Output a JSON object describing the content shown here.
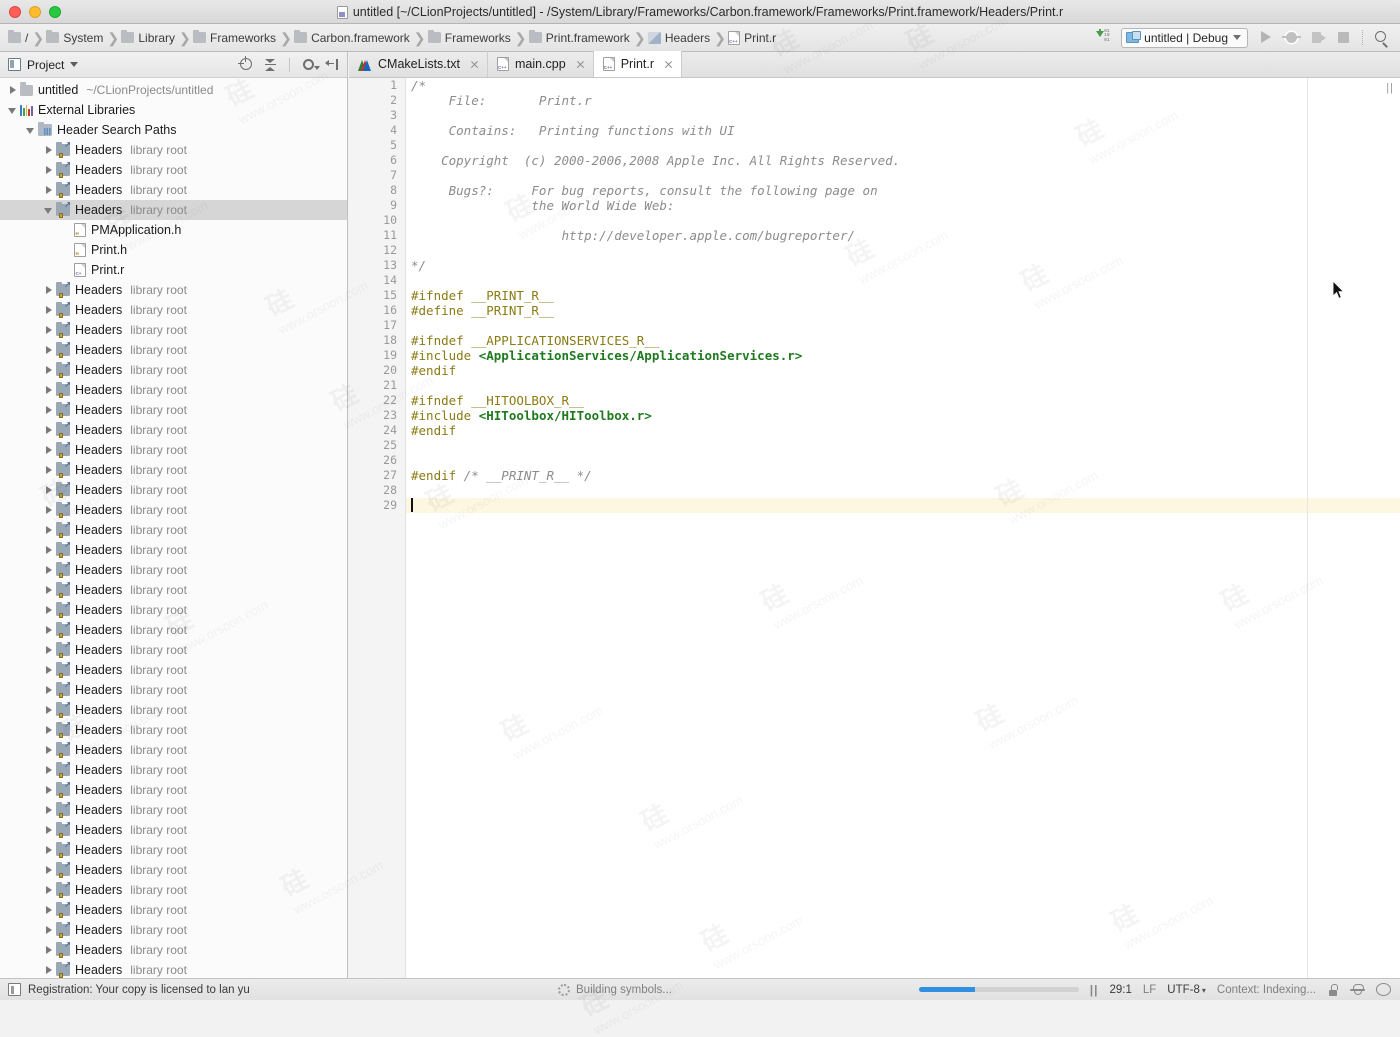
{
  "window": {
    "title": "untitled [~/CLionProjects/untitled] - /System/Library/Frameworks/Carbon.framework/Frameworks/Print.framework/Headers/Print.r",
    "controls": [
      "close",
      "minimize",
      "zoom"
    ]
  },
  "breadcrumbs": [
    {
      "label": "/",
      "icon": "folder-icon"
    },
    {
      "label": "System",
      "icon": "folder-icon"
    },
    {
      "label": "Library",
      "icon": "folder-icon"
    },
    {
      "label": "Frameworks",
      "icon": "folder-icon"
    },
    {
      "label": "Carbon.framework",
      "icon": "folder-icon"
    },
    {
      "label": "Frameworks",
      "icon": "folder-icon"
    },
    {
      "label": "Print.framework",
      "icon": "folder-icon"
    },
    {
      "label": "Headers",
      "icon": "headers-folder-icon"
    },
    {
      "label": "Print.r",
      "icon": "cpp-file-icon"
    }
  ],
  "toolbar": {
    "sync_icon": "update-sync-icon",
    "run_config": "untitled | Debug",
    "buttons": [
      "run-button",
      "debug-button",
      "profile-button",
      "stop-button",
      "search-button"
    ]
  },
  "project_panel": {
    "title": "Project",
    "tools": [
      "locate-icon",
      "collapse-all-icon",
      "settings-gear-icon",
      "hide-panel-icon"
    ],
    "tree": [
      {
        "name": "untitled",
        "sub": "~/CLionProjects/untitled",
        "indent": 0,
        "twisty": "closed",
        "icon": "folder-icon",
        "selected": false
      },
      {
        "name": "External Libraries",
        "sub": "",
        "indent": 0,
        "twisty": "open",
        "icon": "library-bars-icon",
        "selected": false
      },
      {
        "name": "Header Search Paths",
        "sub": "",
        "indent": 1,
        "twisty": "open",
        "icon": "header-search-paths-icon",
        "selected": false
      },
      {
        "name": "Headers",
        "sub": "library root",
        "indent": 2,
        "twisty": "closed",
        "icon": "headers-library-icon",
        "selected": false
      },
      {
        "name": "Headers",
        "sub": "library root",
        "indent": 2,
        "twisty": "closed",
        "icon": "headers-library-icon",
        "selected": false
      },
      {
        "name": "Headers",
        "sub": "library root",
        "indent": 2,
        "twisty": "closed",
        "icon": "headers-library-icon",
        "selected": false
      },
      {
        "name": "Headers",
        "sub": "library root",
        "indent": 2,
        "twisty": "open",
        "icon": "headers-library-icon",
        "selected": true
      },
      {
        "name": "PMApplication.h",
        "sub": "",
        "indent": 3,
        "twisty": "none",
        "icon": "h-file-icon",
        "selected": false
      },
      {
        "name": "Print.h",
        "sub": "",
        "indent": 3,
        "twisty": "none",
        "icon": "h-file-icon",
        "selected": false
      },
      {
        "name": "Print.r",
        "sub": "",
        "indent": 3,
        "twisty": "none",
        "icon": "r-file-icon",
        "selected": false
      },
      {
        "name": "Headers",
        "sub": "library root",
        "indent": 2,
        "twisty": "closed",
        "icon": "headers-library-icon",
        "selected": false
      },
      {
        "name": "Headers",
        "sub": "library root",
        "indent": 2,
        "twisty": "closed",
        "icon": "headers-library-icon",
        "selected": false
      },
      {
        "name": "Headers",
        "sub": "library root",
        "indent": 2,
        "twisty": "closed",
        "icon": "headers-library-icon",
        "selected": false
      },
      {
        "name": "Headers",
        "sub": "library root",
        "indent": 2,
        "twisty": "closed",
        "icon": "headers-library-icon",
        "selected": false
      },
      {
        "name": "Headers",
        "sub": "library root",
        "indent": 2,
        "twisty": "closed",
        "icon": "headers-library-icon",
        "selected": false
      },
      {
        "name": "Headers",
        "sub": "library root",
        "indent": 2,
        "twisty": "closed",
        "icon": "headers-library-icon",
        "selected": false
      },
      {
        "name": "Headers",
        "sub": "library root",
        "indent": 2,
        "twisty": "closed",
        "icon": "headers-library-icon",
        "selected": false
      },
      {
        "name": "Headers",
        "sub": "library root",
        "indent": 2,
        "twisty": "closed",
        "icon": "headers-library-icon",
        "selected": false
      },
      {
        "name": "Headers",
        "sub": "library root",
        "indent": 2,
        "twisty": "closed",
        "icon": "headers-library-icon",
        "selected": false
      },
      {
        "name": "Headers",
        "sub": "library root",
        "indent": 2,
        "twisty": "closed",
        "icon": "headers-library-icon",
        "selected": false
      },
      {
        "name": "Headers",
        "sub": "library root",
        "indent": 2,
        "twisty": "closed",
        "icon": "headers-library-icon",
        "selected": false
      },
      {
        "name": "Headers",
        "sub": "library root",
        "indent": 2,
        "twisty": "closed",
        "icon": "headers-library-icon",
        "selected": false
      },
      {
        "name": "Headers",
        "sub": "library root",
        "indent": 2,
        "twisty": "closed",
        "icon": "headers-library-icon",
        "selected": false
      },
      {
        "name": "Headers",
        "sub": "library root",
        "indent": 2,
        "twisty": "closed",
        "icon": "headers-library-icon",
        "selected": false
      },
      {
        "name": "Headers",
        "sub": "library root",
        "indent": 2,
        "twisty": "closed",
        "icon": "headers-library-icon",
        "selected": false
      },
      {
        "name": "Headers",
        "sub": "library root",
        "indent": 2,
        "twisty": "closed",
        "icon": "headers-library-icon",
        "selected": false
      },
      {
        "name": "Headers",
        "sub": "library root",
        "indent": 2,
        "twisty": "closed",
        "icon": "headers-library-icon",
        "selected": false
      },
      {
        "name": "Headers",
        "sub": "library root",
        "indent": 2,
        "twisty": "closed",
        "icon": "headers-library-icon",
        "selected": false
      },
      {
        "name": "Headers",
        "sub": "library root",
        "indent": 2,
        "twisty": "closed",
        "icon": "headers-library-icon",
        "selected": false
      },
      {
        "name": "Headers",
        "sub": "library root",
        "indent": 2,
        "twisty": "closed",
        "icon": "headers-library-icon",
        "selected": false
      },
      {
        "name": "Headers",
        "sub": "library root",
        "indent": 2,
        "twisty": "closed",
        "icon": "headers-library-icon",
        "selected": false
      },
      {
        "name": "Headers",
        "sub": "library root",
        "indent": 2,
        "twisty": "closed",
        "icon": "headers-library-icon",
        "selected": false
      },
      {
        "name": "Headers",
        "sub": "library root",
        "indent": 2,
        "twisty": "closed",
        "icon": "headers-library-icon",
        "selected": false
      },
      {
        "name": "Headers",
        "sub": "library root",
        "indent": 2,
        "twisty": "closed",
        "icon": "headers-library-icon",
        "selected": false
      },
      {
        "name": "Headers",
        "sub": "library root",
        "indent": 2,
        "twisty": "closed",
        "icon": "headers-library-icon",
        "selected": false
      },
      {
        "name": "Headers",
        "sub": "library root",
        "indent": 2,
        "twisty": "closed",
        "icon": "headers-library-icon",
        "selected": false
      },
      {
        "name": "Headers",
        "sub": "library root",
        "indent": 2,
        "twisty": "closed",
        "icon": "headers-library-icon",
        "selected": false
      },
      {
        "name": "Headers",
        "sub": "library root",
        "indent": 2,
        "twisty": "closed",
        "icon": "headers-library-icon",
        "selected": false
      },
      {
        "name": "Headers",
        "sub": "library root",
        "indent": 2,
        "twisty": "closed",
        "icon": "headers-library-icon",
        "selected": false
      },
      {
        "name": "Headers",
        "sub": "library root",
        "indent": 2,
        "twisty": "closed",
        "icon": "headers-library-icon",
        "selected": false
      },
      {
        "name": "Headers",
        "sub": "library root",
        "indent": 2,
        "twisty": "closed",
        "icon": "headers-library-icon",
        "selected": false
      },
      {
        "name": "Headers",
        "sub": "library root",
        "indent": 2,
        "twisty": "closed",
        "icon": "headers-library-icon",
        "selected": false
      },
      {
        "name": "Headers",
        "sub": "library root",
        "indent": 2,
        "twisty": "closed",
        "icon": "headers-library-icon",
        "selected": false
      },
      {
        "name": "Headers",
        "sub": "library root",
        "indent": 2,
        "twisty": "closed",
        "icon": "headers-library-icon",
        "selected": false
      },
      {
        "name": "Headers",
        "sub": "library root",
        "indent": 2,
        "twisty": "closed",
        "icon": "headers-library-icon",
        "selected": false
      }
    ]
  },
  "editor": {
    "tabs": [
      {
        "label": "CMakeLists.txt",
        "icon": "cmake-icon",
        "active": false
      },
      {
        "label": "main.cpp",
        "icon": "cpp-file-icon",
        "active": false
      },
      {
        "label": "Print.r",
        "icon": "cpp-file-icon",
        "active": true
      }
    ],
    "pause_marker": "||",
    "lines": [
      {
        "n": 1,
        "segments": [
          {
            "t": "/*",
            "c": "cm"
          }
        ]
      },
      {
        "n": 2,
        "segments": [
          {
            "t": "     File:       Print.r",
            "c": "cm"
          }
        ]
      },
      {
        "n": 3,
        "segments": []
      },
      {
        "n": 4,
        "segments": [
          {
            "t": "     Contains:   Printing functions with UI",
            "c": "cm"
          }
        ]
      },
      {
        "n": 5,
        "segments": []
      },
      {
        "n": 6,
        "segments": [
          {
            "t": "    Copyright  (c) 2000-2006,2008 Apple Inc. All Rights Reserved.",
            "c": "cm"
          }
        ]
      },
      {
        "n": 7,
        "segments": []
      },
      {
        "n": 8,
        "segments": [
          {
            "t": "     Bugs?:     For bug reports, consult the following page on",
            "c": "cm"
          }
        ]
      },
      {
        "n": 9,
        "segments": [
          {
            "t": "                the World Wide Web:",
            "c": "cm"
          }
        ]
      },
      {
        "n": 10,
        "segments": []
      },
      {
        "n": 11,
        "segments": [
          {
            "t": "                    http://developer.apple.com/bugreporter/",
            "c": "cm"
          }
        ]
      },
      {
        "n": 12,
        "segments": []
      },
      {
        "n": 13,
        "segments": [
          {
            "t": "*/",
            "c": "cm"
          }
        ]
      },
      {
        "n": 14,
        "segments": []
      },
      {
        "n": 15,
        "segments": [
          {
            "t": "#ifndef __PRINT_R__",
            "c": "pp"
          }
        ]
      },
      {
        "n": 16,
        "segments": [
          {
            "t": "#define __PRINT_R__",
            "c": "pp"
          }
        ]
      },
      {
        "n": 17,
        "segments": []
      },
      {
        "n": 18,
        "segments": [
          {
            "t": "#ifndef __APPLICATIONSERVICES_R__",
            "c": "pp"
          }
        ]
      },
      {
        "n": 19,
        "segments": [
          {
            "t": "#include ",
            "c": "pp"
          },
          {
            "t": "<ApplicationServices/ApplicationServices.r>",
            "c": "incl"
          }
        ]
      },
      {
        "n": 20,
        "segments": [
          {
            "t": "#endif",
            "c": "pp"
          }
        ]
      },
      {
        "n": 21,
        "segments": []
      },
      {
        "n": 22,
        "segments": [
          {
            "t": "#ifndef __HITOOLBOX_R__",
            "c": "pp"
          }
        ]
      },
      {
        "n": 23,
        "segments": [
          {
            "t": "#include ",
            "c": "pp"
          },
          {
            "t": "<HIToolbox/HIToolbox.r>",
            "c": "incl"
          }
        ]
      },
      {
        "n": 24,
        "segments": [
          {
            "t": "#endif",
            "c": "pp"
          }
        ]
      },
      {
        "n": 25,
        "segments": []
      },
      {
        "n": 26,
        "segments": []
      },
      {
        "n": 27,
        "segments": [
          {
            "t": "#endif",
            "c": "pp"
          },
          {
            "t": " /* __PRINT_R__ */",
            "c": "cm"
          }
        ]
      },
      {
        "n": 28,
        "segments": []
      },
      {
        "n": 29,
        "segments": [],
        "current": true
      }
    ]
  },
  "statusbar": {
    "registration": "Registration: Your copy is licensed to lan yu",
    "build_status": "Building symbols...",
    "progress_percent": 35,
    "pause_marker": "||",
    "caret_position": "29:1",
    "line_separator": "LF",
    "encoding": "UTF-8",
    "context": "Context: Indexing...",
    "icons": [
      "lock-icon",
      "hector-hat-icon",
      "search-bubble-icon"
    ]
  },
  "colors": {
    "accent_blue": "#2f8fe0",
    "comment_gray": "#8c8c8c",
    "preprocessor_olive": "#8a7b15",
    "include_green": "#1f7a1f",
    "current_line": "#fdf6e0",
    "selection_gray": "#d6d6d6"
  }
}
